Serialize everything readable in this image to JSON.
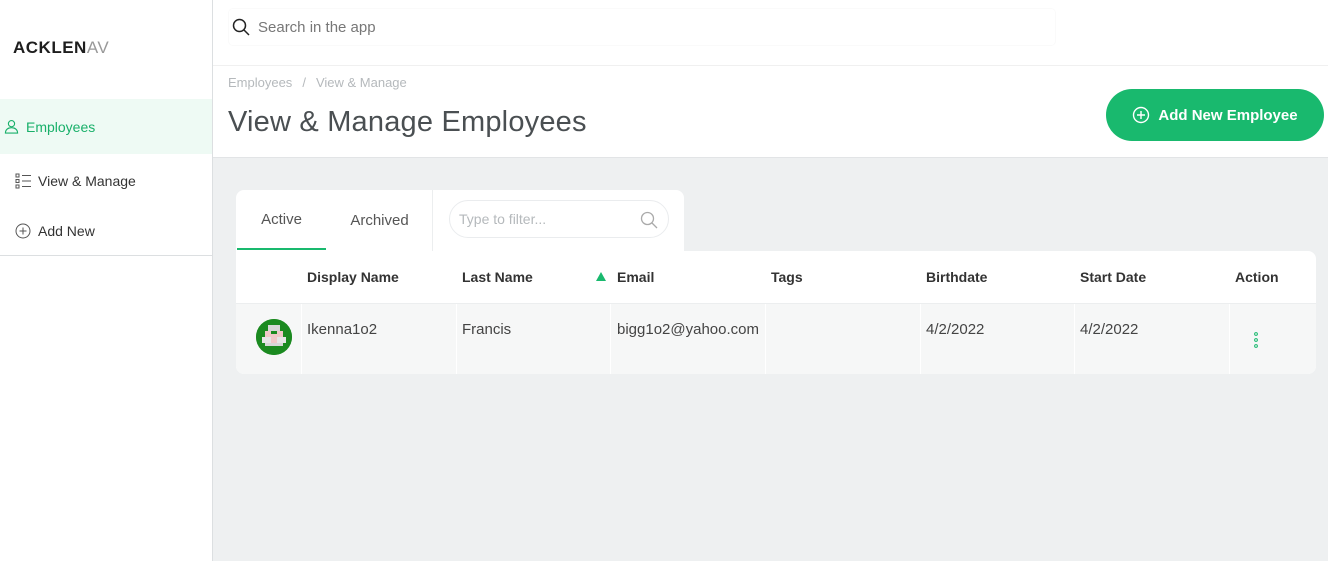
{
  "brand": {
    "name": "ACKLEN",
    "name_tail": "AV"
  },
  "sidebar": {
    "items": [
      {
        "label": "Employees",
        "icon": "user-icon",
        "active": true
      },
      {
        "label": "View & Manage",
        "icon": "list-icon"
      },
      {
        "label": "Add New",
        "icon": "plus-circle-icon"
      }
    ]
  },
  "search": {
    "placeholder": "Search in the app"
  },
  "breadcrumb": {
    "items": [
      "Employees",
      "View & Manage"
    ],
    "separator": "/"
  },
  "page": {
    "title": "View & Manage Employees"
  },
  "actions": {
    "add_label": "Add New Employee"
  },
  "tabs": [
    {
      "label": "Active",
      "active": true
    },
    {
      "label": "Archived"
    }
  ],
  "filter": {
    "placeholder": "Type to filter..."
  },
  "table": {
    "columns": [
      "Display Name",
      "Last Name",
      "Email",
      "Tags",
      "Birthdate",
      "Start Date",
      "Action"
    ],
    "sorted_column": "Email",
    "rows": [
      {
        "display_name": "Ikenna1o2",
        "last_name": "Francis",
        "email": "bigg1o2@yahoo.com",
        "tags": "",
        "birthdate": "4/2/2022",
        "start_date": "4/2/2022"
      }
    ]
  },
  "colors": {
    "accent": "#19b96e",
    "background": "#eef0f1"
  }
}
